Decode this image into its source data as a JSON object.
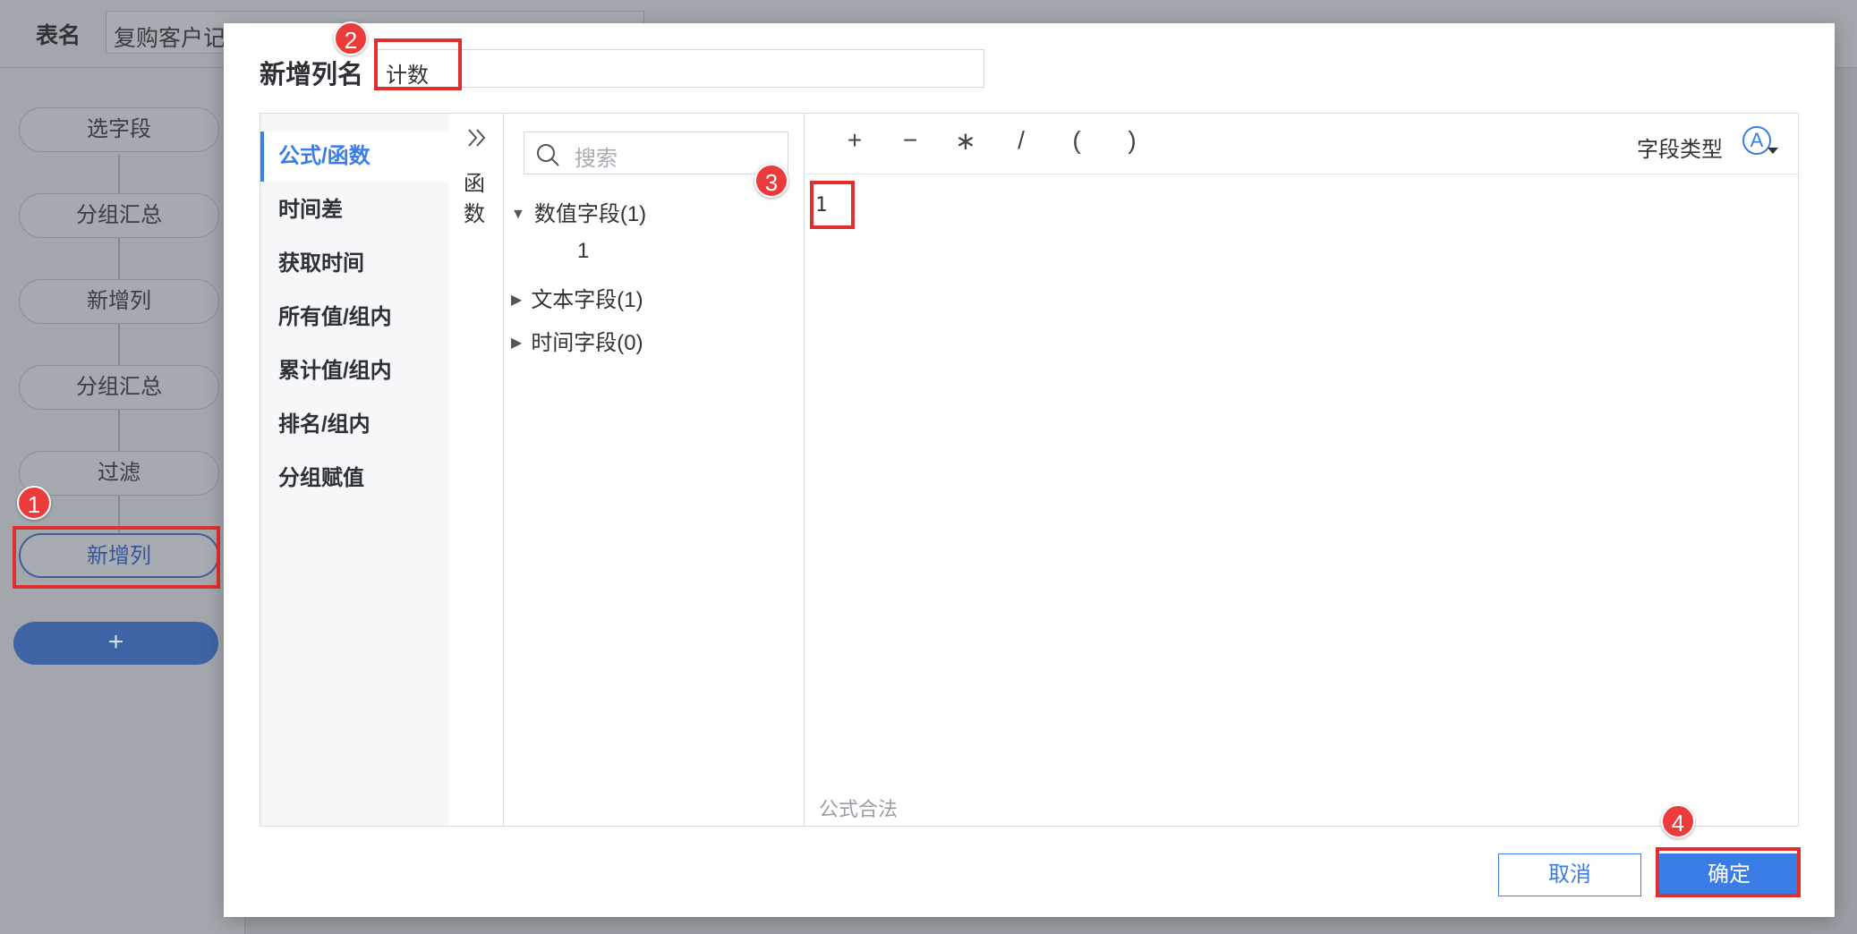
{
  "background": {
    "table_name_label": "表名",
    "table_name_value": "复购客户记录",
    "steps": [
      "选字段",
      "分组汇总",
      "新增列",
      "分组汇总",
      "过滤",
      "新增列"
    ],
    "add_label": "+"
  },
  "dialog": {
    "title": "新增列名",
    "column_name_value": "计数",
    "categories": [
      "公式/函数",
      "时间差",
      "获取时间",
      "所有值/组内",
      "累计值/组内",
      "排名/组内",
      "分组赋值"
    ],
    "func_toggle_label": "函数",
    "search_placeholder": "搜索",
    "field_groups": {
      "numeric": "数值字段(1)",
      "numeric_child": "1",
      "text": "文本字段(1)",
      "time": "时间字段(0)"
    },
    "operators": [
      "+",
      "−",
      "∗",
      "/",
      "(",
      ")"
    ],
    "field_type_label": "字段类型",
    "field_type_icon_text": "A",
    "formula_value": "1",
    "formula_status": "公式合法",
    "cancel_label": "取消",
    "ok_label": "确定"
  },
  "annotations": [
    "1",
    "2",
    "3",
    "4"
  ],
  "colors": {
    "accent": "#3a7de6",
    "annotation_red": "#e02f2f",
    "overlay": "#9a9ea4"
  }
}
